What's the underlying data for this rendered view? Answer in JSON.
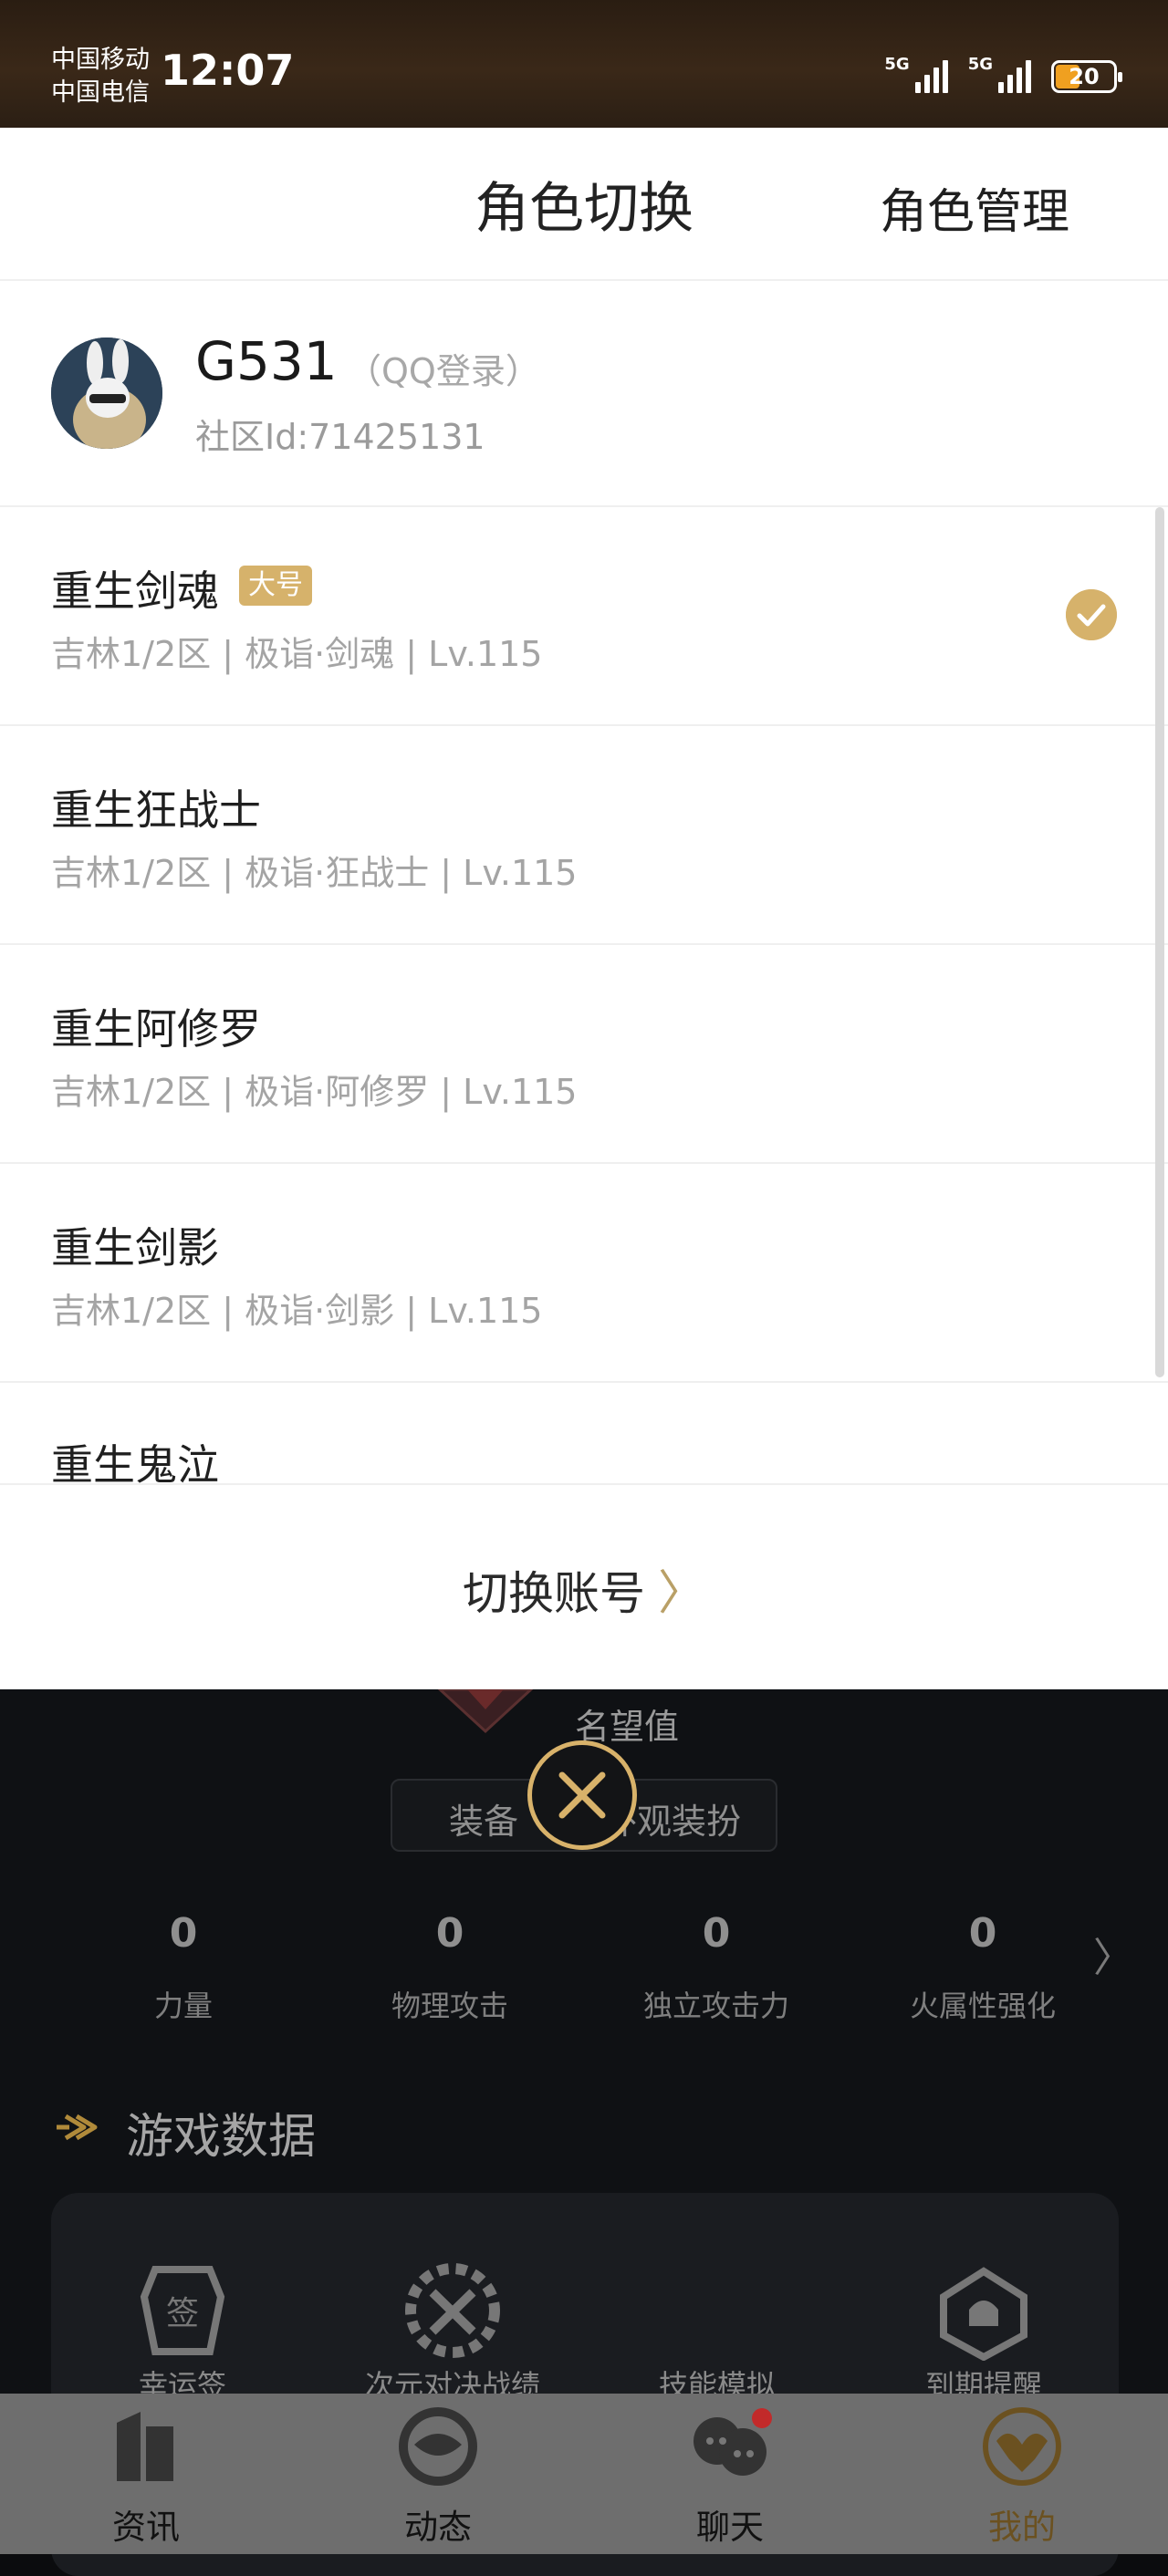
{
  "status_bar": {
    "carrier_1": "中国移动",
    "carrier_2": "中国电信",
    "time": "12:07",
    "network_1": "5G",
    "network_2": "5G",
    "battery": "20",
    "battery_color": "#f0a020"
  },
  "sheet": {
    "title": "角色切换",
    "manage_label": "角色管理",
    "account": {
      "name": "G531",
      "login_type": "（QQ登录）",
      "community_id": "社区Id:71425131"
    },
    "roles": [
      {
        "name": "重生剑魂",
        "badge": "大号",
        "meta": "吉林1/2区 | 极诣·剑魂 | Lv.115",
        "selected": true
      },
      {
        "name": "重生狂战士",
        "meta": "吉林1/2区 | 极诣·狂战士 | Lv.115"
      },
      {
        "name": "重生阿修罗",
        "meta": "吉林1/2区 | 极诣·阿修罗 | Lv.115"
      },
      {
        "name": "重生剑影",
        "meta": "吉林1/2区 | 极诣·剑影 | Lv.115"
      },
      {
        "name": "重生鬼泣"
      }
    ],
    "switch_account": "切换账号",
    "switch_arrow": "〉"
  },
  "background": {
    "fame_label": "名望值",
    "tab_equip": "装备",
    "tab_look": "外观装扮",
    "stats": [
      {
        "value": "0",
        "label": "力量"
      },
      {
        "value": "0",
        "label": "物理攻击"
      },
      {
        "value": "0",
        "label": "独立攻击力"
      },
      {
        "value": "0",
        "label": "火属性强化"
      }
    ],
    "stats_more": "〉",
    "section_title": "游戏数据",
    "tools": [
      "幸运签",
      "次元对决战绩",
      "技能模拟",
      "到期提醒"
    ]
  },
  "bottom_nav": [
    {
      "label": "资讯"
    },
    {
      "label": "动态"
    },
    {
      "label": "聊天"
    },
    {
      "label": "我的"
    }
  ],
  "accent_color": "#d6b26b"
}
